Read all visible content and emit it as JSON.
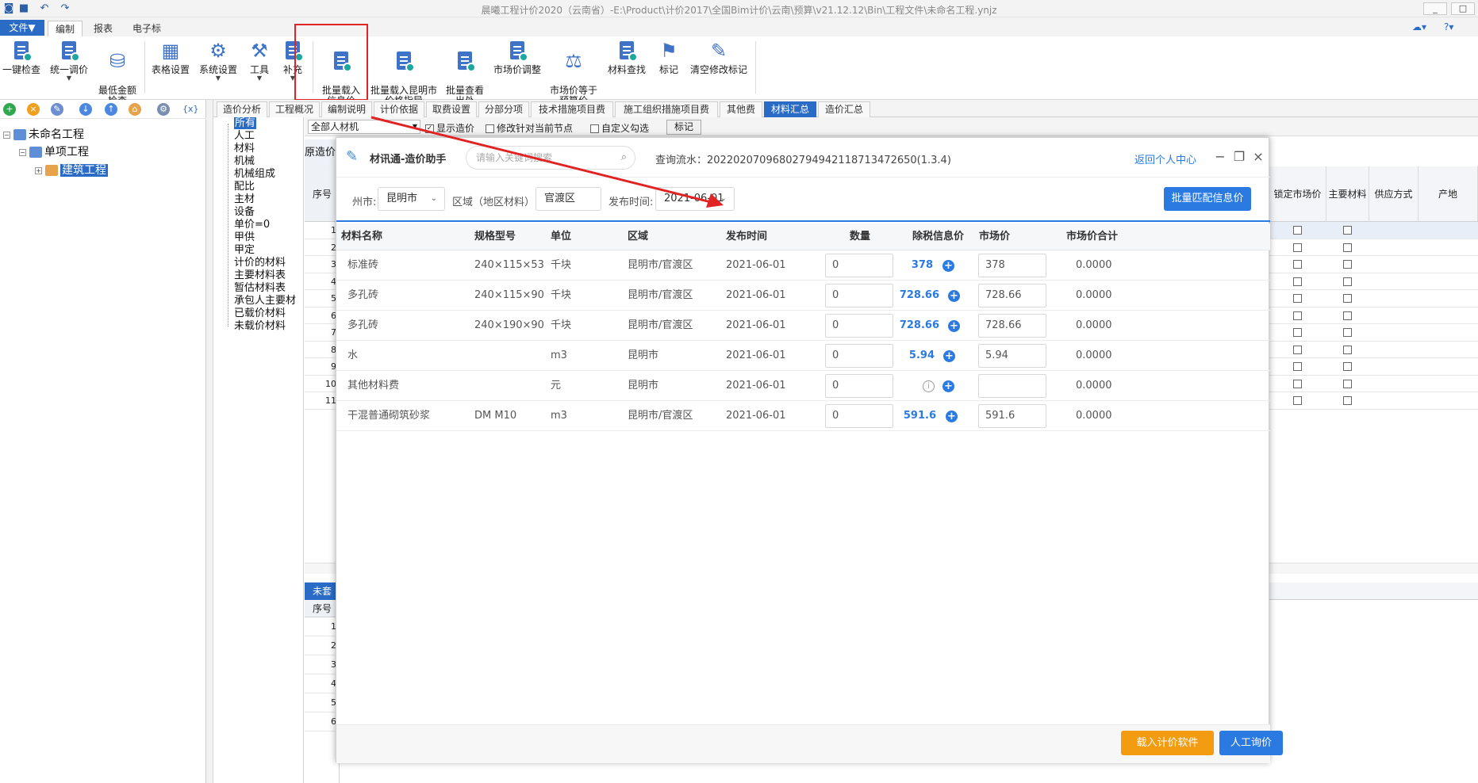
{
  "window": {
    "title": "晨曦工程计价2020（云南省）-E:\\Product\\计价2017\\全国Bim计价\\云南\\预算\\v21.12.12\\Bin\\工程文件\\未命名工程.ynjz",
    "controls": [
      "_",
      "□",
      "×"
    ]
  },
  "menu": {
    "file": "文件▼",
    "tabs": [
      "编制",
      "报表",
      "电子标"
    ]
  },
  "ribbon": {
    "buttons": [
      {
        "label": "一键检查",
        "icon": "check-doc-icon"
      },
      {
        "label": "统一调价",
        "icon": "price-adjust-icon"
      },
      {
        "label": "最低金额\n检查",
        "icon": "coins-icon"
      },
      {
        "label": "表格设置",
        "icon": "table-settings-icon"
      },
      {
        "label": "系统设置",
        "icon": "system-settings-icon"
      },
      {
        "label": "工具",
        "icon": "toolbox-icon"
      },
      {
        "label": "补充",
        "icon": "supplement-icon"
      },
      {
        "label": "批量载入\n信息价",
        "icon": "batch-load-info-icon"
      },
      {
        "label": "批量载入昆明市\n价格指导",
        "icon": "batch-load-guide-icon"
      },
      {
        "label": "批量查看\n出处",
        "icon": "view-source-icon"
      },
      {
        "label": "市场价调整",
        "icon": "market-adjust-icon"
      },
      {
        "label": "市场价等于\n预算价",
        "icon": "scale-icon"
      },
      {
        "label": "材料查找",
        "icon": "material-search-icon"
      },
      {
        "label": "标记",
        "icon": "flag-icon"
      },
      {
        "label": "清空修改标记",
        "icon": "broom-icon"
      }
    ]
  },
  "tree": {
    "root": "未命名工程",
    "child": "单项工程",
    "leaf": "建筑工程"
  },
  "doc_tabs": [
    "造价分析",
    "工程概况",
    "编制说明",
    "计价依据",
    "取费设置",
    "分部分项",
    "技术措施项目费",
    "施工组织措施项目费",
    "其他费",
    "材料汇总",
    "造价汇总"
  ],
  "categories": [
    "所有",
    "人工",
    "材料",
    "机械",
    "机械组成",
    "配比",
    "主材",
    "设备",
    "单价=0",
    "甲供",
    "甲定",
    "计价的材料",
    "主要材料表",
    "暂估材料表",
    "承包人主要材",
    "已载价材料",
    "未载价材料"
  ],
  "filter": {
    "scope": "全部人材机",
    "show_price": "显示造价",
    "modify_current": "修改针对当前节点",
    "custom_check": "自定义勾选",
    "mark": "标记"
  },
  "grid": {
    "partial_header": "原造价",
    "seq_header": "序号",
    "rows": [
      "1",
      "2",
      "3",
      "4",
      "5",
      "6",
      "7",
      "8",
      "9",
      "10",
      "11"
    ],
    "right_headers": [
      "锁定市场价",
      "主要材料",
      "供应方式",
      "产地"
    ]
  },
  "bottom_grid": {
    "title": "未套",
    "seq_header": "序号",
    "rows": [
      "1",
      "2",
      "3",
      "4",
      "5",
      "6"
    ]
  },
  "dialog": {
    "title": "材讯通-造价助手",
    "search_placeholder": "请输入关键词搜索",
    "serial": "查询流水：20220207096802794942118713472650(1.3.4)",
    "back_link": "返回个人中心",
    "city_label": "州市:",
    "city": "昆明市",
    "region_label": "区域（地区材料）:",
    "region": "官渡区",
    "date_label": "发布时间:",
    "date": "2021-06-01",
    "batch_button": "批量匹配信息价",
    "columns": [
      "材料名称",
      "规格型号",
      "单位",
      "区域",
      "发布时间",
      "数量",
      "除税信息价",
      "市场价",
      "市场价合计"
    ],
    "rows": [
      {
        "name": "标准砖",
        "spec": "240×115×53",
        "unit": "千块",
        "area": "昆明市/官渡区",
        "date": "2021-06-01",
        "qty": "0",
        "info_price": "378",
        "market": "378",
        "total": "0.0000"
      },
      {
        "name": "多孔砖",
        "spec": "240×115×90",
        "unit": "千块",
        "area": "昆明市/官渡区",
        "date": "2021-06-01",
        "qty": "0",
        "info_price": "728.66",
        "market": "728.66",
        "total": "0.0000"
      },
      {
        "name": "多孔砖",
        "spec": "240×190×90",
        "unit": "千块",
        "area": "昆明市/官渡区",
        "date": "2021-06-01",
        "qty": "0",
        "info_price": "728.66",
        "market": "728.66",
        "total": "0.0000"
      },
      {
        "name": "水",
        "spec": "",
        "unit": "m3",
        "area": "昆明市",
        "date": "2021-06-01",
        "qty": "0",
        "info_price": "5.94",
        "market": "5.94",
        "total": "0.0000"
      },
      {
        "name": "其他材料费",
        "spec": "",
        "unit": "元",
        "area": "昆明市",
        "date": "2021-06-01",
        "qty": "0",
        "info_price": "",
        "market": "",
        "total": "0.0000"
      },
      {
        "name": "干混普通砌筑砂浆",
        "spec": "DM M10",
        "unit": "m3",
        "area": "昆明市/官渡区",
        "date": "2021-06-01",
        "qty": "0",
        "info_price": "591.6",
        "market": "591.6",
        "total": "0.0000"
      }
    ],
    "load_button": "载入计价软件",
    "manual_button": "人工询价"
  }
}
